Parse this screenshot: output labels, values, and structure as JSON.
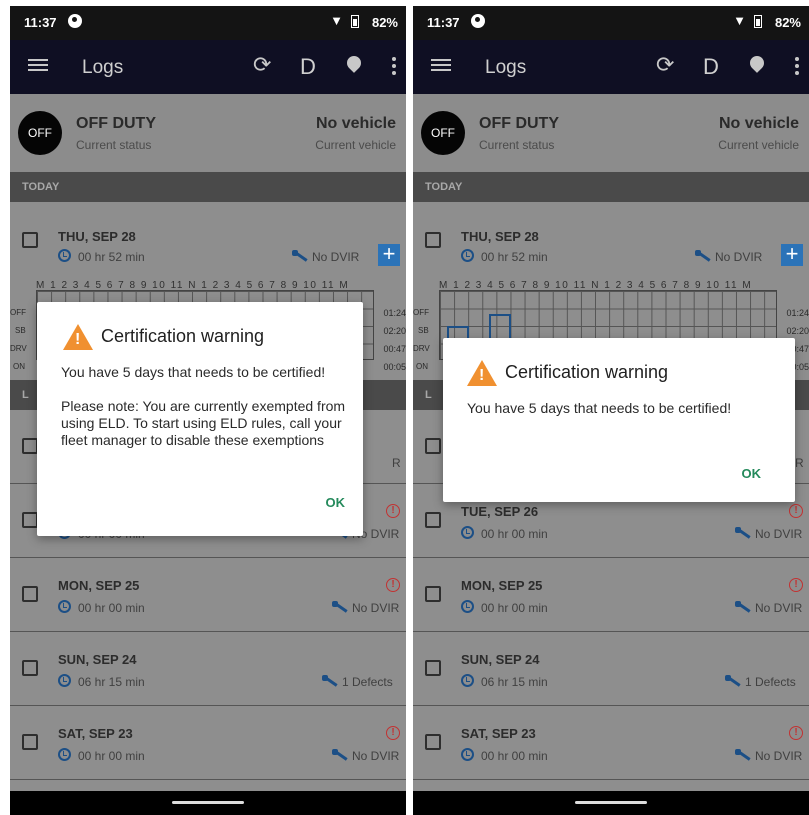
{
  "status_bar": {
    "time": "11:37",
    "battery": "82%"
  },
  "appbar": {
    "title": "Logs",
    "d_button": "D"
  },
  "status": {
    "badge": "OFF",
    "duty": "OFF DUTY",
    "duty_sub": "Current status",
    "vehicle": "No vehicle",
    "vehicle_sub": "Current vehicle"
  },
  "sections": {
    "today": "TODAY"
  },
  "today": {
    "date": "THU, SEP 28",
    "duration": "00 hr 52 min",
    "dvir": "No DVIR",
    "add": "+",
    "hours": "M 1 2 3 4 5 6 7 8 9 10 11 N 1 2 3 4 5 6 7 8 9 10 11 M",
    "grid_labels": [
      "OFF",
      "SB",
      "DRV",
      "ON"
    ],
    "grid_values": [
      "01:24",
      "02:20",
      "00:47",
      "00:05"
    ]
  },
  "days": [
    {
      "date": "TUE, SEP 26",
      "duration": "00 hr 00 min",
      "dvir": "No DVIR"
    },
    {
      "date": "MON, SEP 25",
      "duration": "00 hr 00 min",
      "dvir": "No DVIR"
    },
    {
      "date": "SUN, SEP 24",
      "duration": "06 hr 15 min",
      "dvir": "1 Defects"
    },
    {
      "date": "SAT, SEP 23",
      "duration": "00 hr 00 min",
      "dvir": "No DVIR"
    }
  ],
  "left_dialog": {
    "title": "Certification warning",
    "message": "You have 5 days that needs to be certified!",
    "note": "Please note: You are currently exempted from using ELD. To start using ELD rules, call your fleet manager to disable these exemptions",
    "ok": "OK"
  },
  "right_dialog": {
    "title": "Certification warning",
    "message": "You have 5 days that needs to be certified!",
    "ok": "OK"
  },
  "partial": {
    "section_letter": "L",
    "dvir_tail": "R"
  }
}
